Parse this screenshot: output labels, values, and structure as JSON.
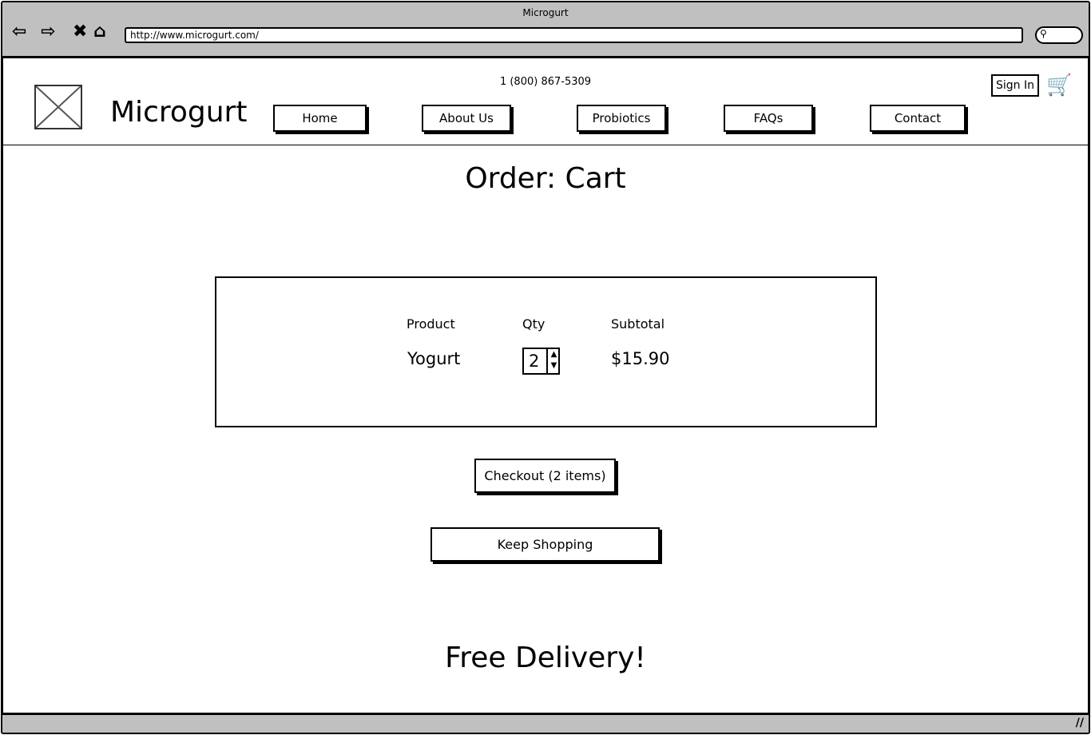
{
  "browser": {
    "title": "Microgurt",
    "url": "http://www.microgurt.com/"
  },
  "header": {
    "brand": "Microgurt",
    "phone": "1 (800) 867-5309",
    "sign_in": "Sign In",
    "nav": [
      "Home",
      "About Us",
      "Probiotics",
      "FAQs",
      "Contact"
    ]
  },
  "page": {
    "title": "Order: Cart"
  },
  "cart": {
    "headers": {
      "product": "Product",
      "qty": "Qty",
      "subtotal": "Subtotal"
    },
    "items": [
      {
        "product": "Yogurt",
        "qty": "2",
        "subtotal": "$15.90"
      }
    ]
  },
  "actions": {
    "checkout": "Checkout (2 items)",
    "keep_shopping": "Keep Shopping"
  },
  "promo": "Free Delivery!"
}
